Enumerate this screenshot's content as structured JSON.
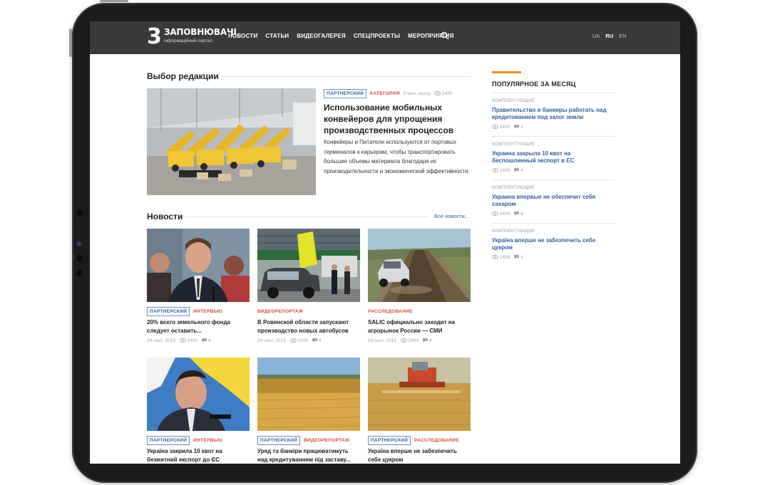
{
  "site": {
    "logo_digit": "3",
    "logo_name": "ЗАПОВНЮВАЧІ",
    "logo_tagline": "інформаційний портал"
  },
  "nav": [
    "НОВОСТИ",
    "СТАТЬИ",
    "ВИДЕОГАЛЕРЕЯ",
    "СПЕЦПРОЕКТЫ",
    "МЕРОПРИЯТИЯ"
  ],
  "languages": [
    {
      "code": "UA",
      "active": false
    },
    {
      "code": "RU",
      "active": true
    },
    {
      "code": "EN",
      "active": false
    }
  ],
  "editors_choice": {
    "heading": "Выбор редакции",
    "tag_partner": "ПАРТНЕРСКИЙ",
    "tag_category": "КАТЕГОРИЯ",
    "time": "5 мин. назад",
    "views": "2499",
    "title": "Использование мобильных конвейеров для упрощения производственных процессов",
    "description": "Конвейеры и Питатели используются от портовых терминалов к карьерам, чтобы транспортировать большие объемы материала благодаря их производительности и экономической эффективности."
  },
  "news": {
    "heading": "Новости",
    "all_link": "Все новости...",
    "cards": [
      {
        "partner": "ПАРТНЕРСКИЙ",
        "category": "ИНТЕРВЬЮ",
        "title": "20% всего земельного фонда следует оставить...",
        "date": "24 сент. 2019",
        "views": "2499",
        "comments": "4"
      },
      {
        "partner": "",
        "category": "ВИДЕОРЕПОРТАЖ",
        "title": "В Ровенской области запускают производство новых автобусов",
        "date": "24 сент. 2019",
        "views": "2499",
        "comments": "4"
      },
      {
        "partner": "",
        "category": "РАССЛЕДОВАНИЕ",
        "title": "SALIC официально заходит на агрорынок России — СМИ",
        "date": "24 сент. 2019",
        "views": "2499",
        "comments": "4"
      },
      {
        "partner": "ПАРТНЕРСКИЙ",
        "category": "ИНТЕРВЬЮ",
        "title": "Україна закрила 10 квот на безмитний експорт до ЄС",
        "date": "",
        "views": "",
        "comments": ""
      },
      {
        "partner": "ПАРТНЕРСКИЙ",
        "category": "ВИДЕОРЕПОРТАЖ",
        "title": "Уряд та банкіри працюватимуть над кредитуванням під заставу...",
        "date": "",
        "views": "",
        "comments": ""
      },
      {
        "partner": "ПАРТНЕРСКИЙ",
        "category": "РАССЛЕДОВАНИЕ",
        "title": "Україна вперше не забезпечить себе цукром",
        "date": "",
        "views": "",
        "comments": ""
      }
    ]
  },
  "popular": {
    "heading": "ПОПУЛЯРНОЕ ЗА МЕСЯЦ",
    "items": [
      {
        "category": "КОМПЛЕКТУЮЩИЕ",
        "title": "Правительство и банкиры работать над кредитованием под залог земли",
        "views": "2499",
        "comments": "4"
      },
      {
        "category": "КОМПЛЕКТУЮЩИЕ",
        "title": "Украина закрыла 10 квот на беспошлинный экспорт в ЕС",
        "views": "2499",
        "comments": "4"
      },
      {
        "category": "КОМПЛЕКТУЮЩИЕ",
        "title": "Украина впервые не обеспечит себя сахаром",
        "views": "2499",
        "comments": "4"
      },
      {
        "category": "КОМПЛЕКТУЮЩИЕ",
        "title": "Україна вперше не забезпечить себе цукром",
        "views": "2499",
        "comments": "4"
      }
    ]
  },
  "colors": {
    "topbar": "#3a3a3b",
    "link_blue": "#2f5f9e",
    "tag_red": "#d14b2e",
    "accent_orange": "#f08a24"
  }
}
